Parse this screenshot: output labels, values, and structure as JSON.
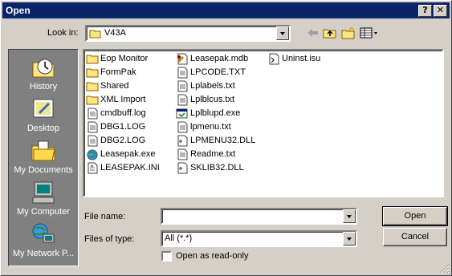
{
  "dialog": {
    "title": "Open",
    "help_button": "?",
    "close_button": "✕"
  },
  "look_in": {
    "label": "Look in:",
    "value": "V43A"
  },
  "places": [
    {
      "label": "History",
      "icon": "history-icon"
    },
    {
      "label": "Desktop",
      "icon": "desktop-icon"
    },
    {
      "label": "My Documents",
      "icon": "my-documents-icon"
    },
    {
      "label": "My Computer",
      "icon": "my-computer-icon"
    },
    {
      "label": "My Network P...",
      "icon": "my-network-places-icon"
    }
  ],
  "files": {
    "col1": [
      {
        "name": "Eop Monitor",
        "icon": "folder-icon"
      },
      {
        "name": "FormPak",
        "icon": "folder-icon"
      },
      {
        "name": "Shared",
        "icon": "folder-icon"
      },
      {
        "name": "XML Import",
        "icon": "folder-icon"
      },
      {
        "name": "cmdbuff.log",
        "icon": "text-file-icon"
      },
      {
        "name": "DBG1.LOG",
        "icon": "text-file-icon"
      },
      {
        "name": "DBG2.LOG",
        "icon": "text-file-icon"
      },
      {
        "name": "Leasepak.exe",
        "icon": "globe-exe-icon"
      },
      {
        "name": "LEASEPAK.INI",
        "icon": "ini-file-icon"
      }
    ],
    "col2": [
      {
        "name": "Leasepak.mdb",
        "icon": "access-db-icon"
      },
      {
        "name": "LPCODE.TXT",
        "icon": "text-file-icon"
      },
      {
        "name": "Lplabels.txt",
        "icon": "text-file-icon"
      },
      {
        "name": "Lplblcus.txt",
        "icon": "text-file-icon"
      },
      {
        "name": "Lplblupd.exe",
        "icon": "exe-icon"
      },
      {
        "name": "lpmenu.txt",
        "icon": "text-file-icon"
      },
      {
        "name": "LPMENU32.DLL",
        "icon": "dll-icon"
      },
      {
        "name": "Readme.txt",
        "icon": "text-file-icon"
      },
      {
        "name": "SKLIB32.DLL",
        "icon": "dll-icon"
      }
    ],
    "col3": [
      {
        "name": "Uninst.isu",
        "icon": "isu-file-icon"
      }
    ]
  },
  "file_name": {
    "label": "File name:",
    "value": ""
  },
  "file_type": {
    "label": "Files of type:",
    "value": "All (*.*)"
  },
  "read_only": {
    "label": "Open as read-only",
    "checked": false
  },
  "buttons": {
    "open": "Open",
    "cancel": "Cancel"
  }
}
